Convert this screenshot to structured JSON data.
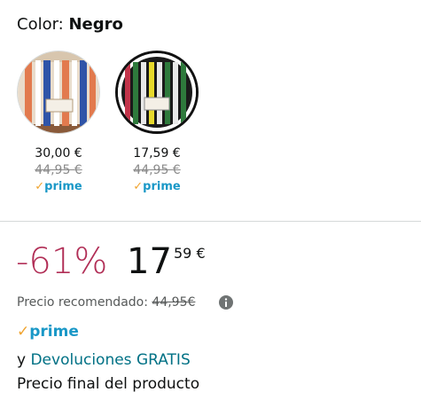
{
  "color": {
    "label": "Color: ",
    "value": "Negro"
  },
  "swatches": [
    {
      "price": "30,00 €",
      "old_price": "44,95 €",
      "prime_check": "✓",
      "prime": "prime",
      "selected": false,
      "icon": "swatch-light-stripes"
    },
    {
      "price": "17,59 €",
      "old_price": "44,95 €",
      "prime_check": "✓",
      "prime": "prime",
      "selected": true,
      "icon": "swatch-black-stripes"
    }
  ],
  "deal": {
    "discount": "-61%",
    "price_whole": "17",
    "price_fraction": "59 €"
  },
  "recommended": {
    "label": "Precio recomendado: ",
    "value": "44,95€",
    "icon": "info-icon"
  },
  "prime": {
    "check": "✓",
    "label": "prime"
  },
  "returns": {
    "prefix": "y ",
    "link": "Devoluciones GRATIS"
  },
  "final_price_note": "Precio final del producto",
  "colors": {
    "discount": "#b12e56",
    "prime_blue": "#1a98c7",
    "prime_check": "#f0a430",
    "link": "#007185"
  }
}
